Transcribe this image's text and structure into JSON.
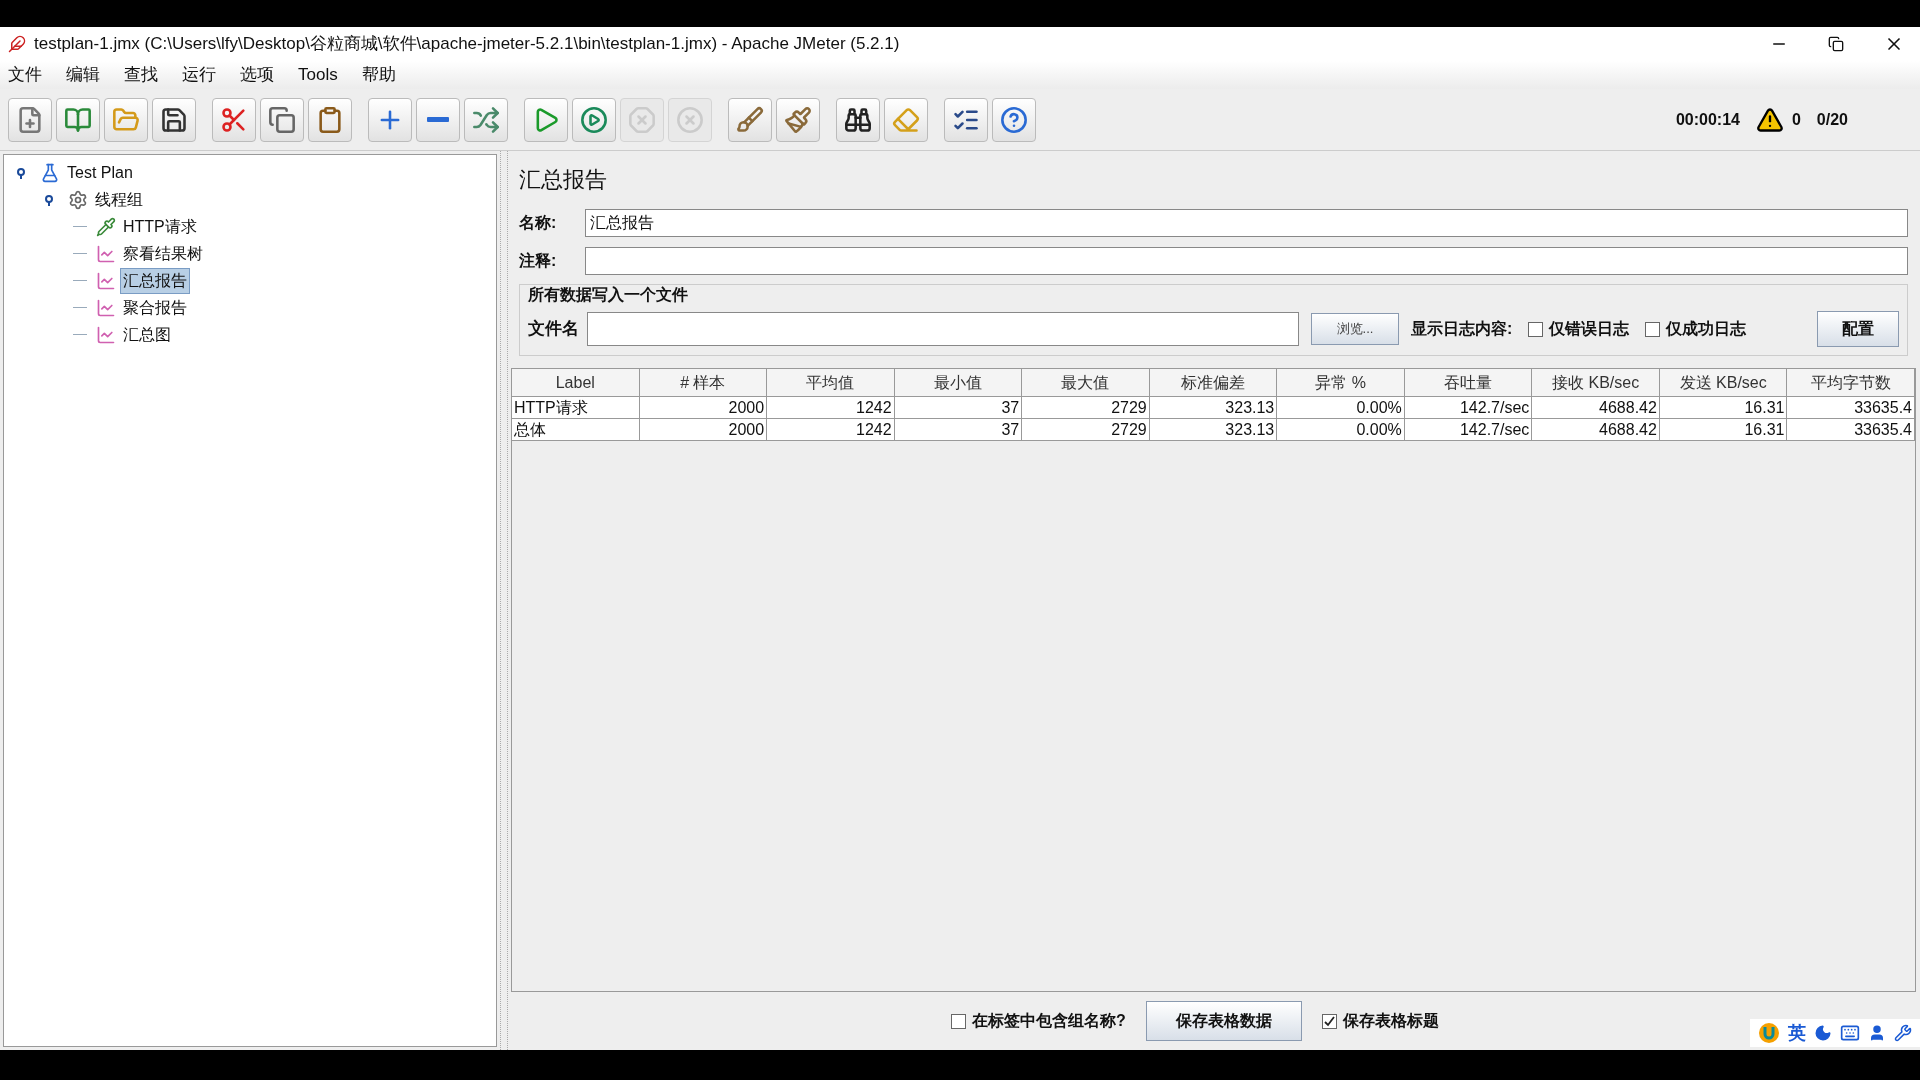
{
  "window": {
    "title": "testplan-1.jmx (C:\\Users\\lfy\\Desktop\\谷粒商城\\软件\\apache-jmeter-5.2.1\\bin\\testplan-1.jmx) - Apache JMeter (5.2.1)"
  },
  "menu": [
    "文件",
    "编辑",
    "查找",
    "运行",
    "选项",
    "Tools",
    "帮助"
  ],
  "toolbar": [
    {
      "kind": "new",
      "disabled": false
    },
    {
      "kind": "templates",
      "disabled": false
    },
    {
      "kind": "open",
      "disabled": false
    },
    {
      "kind": "save",
      "disabled": false
    },
    {
      "kind": "sep"
    },
    {
      "kind": "cut",
      "disabled": false
    },
    {
      "kind": "copy",
      "disabled": false
    },
    {
      "kind": "paste",
      "disabled": false
    },
    {
      "kind": "sep"
    },
    {
      "kind": "expand",
      "disabled": false
    },
    {
      "kind": "collapse",
      "disabled": false
    },
    {
      "kind": "toggle",
      "disabled": false
    },
    {
      "kind": "sep"
    },
    {
      "kind": "start",
      "disabled": false
    },
    {
      "kind": "start-no-pause",
      "disabled": false
    },
    {
      "kind": "stop",
      "disabled": true
    },
    {
      "kind": "shutdown",
      "disabled": true
    },
    {
      "kind": "sep"
    },
    {
      "kind": "clear",
      "disabled": false
    },
    {
      "kind": "clear-all",
      "disabled": false
    },
    {
      "kind": "sep"
    },
    {
      "kind": "search",
      "disabled": false
    },
    {
      "kind": "reset-search",
      "disabled": false
    },
    {
      "kind": "sep"
    },
    {
      "kind": "function",
      "disabled": false
    },
    {
      "kind": "help",
      "disabled": false
    }
  ],
  "status": {
    "elapsed": "00:00:14",
    "warnings": "0",
    "threads": "0/20"
  },
  "tree": [
    {
      "label": "Test Plan",
      "kind": "plan",
      "expanded": true,
      "selected": false,
      "children": [
        {
          "label": "线程组",
          "kind": "threads",
          "expanded": true,
          "selected": false,
          "children": [
            {
              "label": "HTTP请求",
              "kind": "sampler",
              "selected": false
            },
            {
              "label": "察看结果树",
              "kind": "listener",
              "selected": false
            },
            {
              "label": "汇总报告",
              "kind": "listener",
              "selected": true
            },
            {
              "label": "聚合报告",
              "kind": "listener",
              "selected": false
            },
            {
              "label": "汇总图",
              "kind": "listener",
              "selected": false
            }
          ]
        }
      ]
    }
  ],
  "panel": {
    "title": "汇总报告",
    "name_label": "名称:",
    "name_value": "汇总报告",
    "comment_label": "注释:",
    "file_group": {
      "title": "所有数据写入一个文件",
      "file_label": "文件名",
      "browse": "浏览...",
      "log_label": "显示日志内容:",
      "errors_only": {
        "label": "仅错误日志",
        "checked": false
      },
      "success_only": {
        "label": "仅成功日志",
        "checked": false
      },
      "configure": "配置"
    },
    "table": {
      "columns": [
        "Label",
        "# 样本",
        "平均值",
        "最小值",
        "最大值",
        "标准偏差",
        "异常 %",
        "吞吐量",
        "接收 KB/sec",
        "发送 KB/sec",
        "平均字节数"
      ],
      "rows": [
        [
          "HTTP请求",
          "2000",
          "1242",
          "37",
          "2729",
          "323.13",
          "0.00%",
          "142.7/sec",
          "4688.42",
          "16.31",
          "33635.4"
        ],
        [
          "总体",
          "2000",
          "1242",
          "37",
          "2729",
          "323.13",
          "0.00%",
          "142.7/sec",
          "4688.42",
          "16.31",
          "33635.4"
        ]
      ]
    },
    "footer": {
      "include_group": {
        "label": "在标签中包含组名称?",
        "checked": false
      },
      "save_data": "保存表格数据",
      "save_header": {
        "label": "保存表格标题",
        "checked": true
      }
    }
  },
  "ime": {
    "mode": "英"
  }
}
